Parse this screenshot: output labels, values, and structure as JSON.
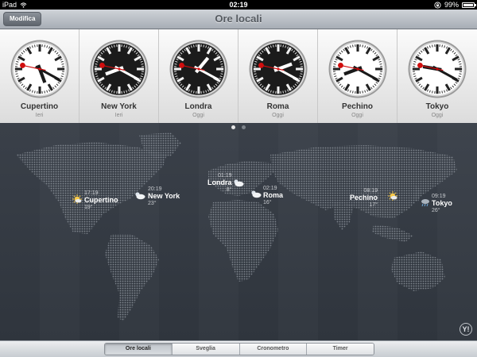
{
  "status": {
    "device": "iPad",
    "time": "02:19",
    "battery": "99%",
    "battery_level": 0.99
  },
  "nav": {
    "edit_label": "Modifica",
    "title": "Ore locali"
  },
  "clocks": [
    {
      "city": "Cupertino",
      "day": "Ieri",
      "theme": "light",
      "hour": 17,
      "minute": 19,
      "second": 47
    },
    {
      "city": "New York",
      "day": "Ieri",
      "theme": "dark",
      "hour": 20,
      "minute": 19,
      "second": 47
    },
    {
      "city": "Londra",
      "day": "Oggi",
      "theme": "dark",
      "hour": 1,
      "minute": 19,
      "second": 47
    },
    {
      "city": "Roma",
      "day": "Oggi",
      "theme": "dark",
      "hour": 2,
      "minute": 19,
      "second": 47
    },
    {
      "city": "Pechino",
      "day": "Oggi",
      "theme": "light",
      "hour": 8,
      "minute": 19,
      "second": 47
    },
    {
      "city": "Tokyo",
      "day": "Oggi",
      "theme": "light",
      "hour": 9,
      "minute": 19,
      "second": 47
    }
  ],
  "map": {
    "pages": 2,
    "active_page": 0,
    "pins": [
      {
        "city": "Cupertino",
        "time": "17:19",
        "temp": "19°",
        "weather": "sunny-icon"
      },
      {
        "city": "New York",
        "time": "20:19",
        "temp": "23°",
        "weather": "cloud-moon-icon"
      },
      {
        "city": "Londra",
        "time": "01:19",
        "temp": "8°",
        "weather": "cloud-moon-icon"
      },
      {
        "city": "Roma",
        "time": "02:19",
        "temp": "16°",
        "weather": "cloud-moon-icon"
      },
      {
        "city": "Pechino",
        "time": "08:19",
        "temp": "17°",
        "weather": "sunny-icon"
      },
      {
        "city": "Tokyo",
        "time": "09:19",
        "temp": "26°",
        "weather": "rain-icon"
      }
    ],
    "credit": "Y!"
  },
  "tabs": [
    {
      "label": "Ore locali",
      "selected": true
    },
    {
      "label": "Sveglia",
      "selected": false
    },
    {
      "label": "Cronometro",
      "selected": false
    },
    {
      "label": "Timer",
      "selected": false
    }
  ]
}
